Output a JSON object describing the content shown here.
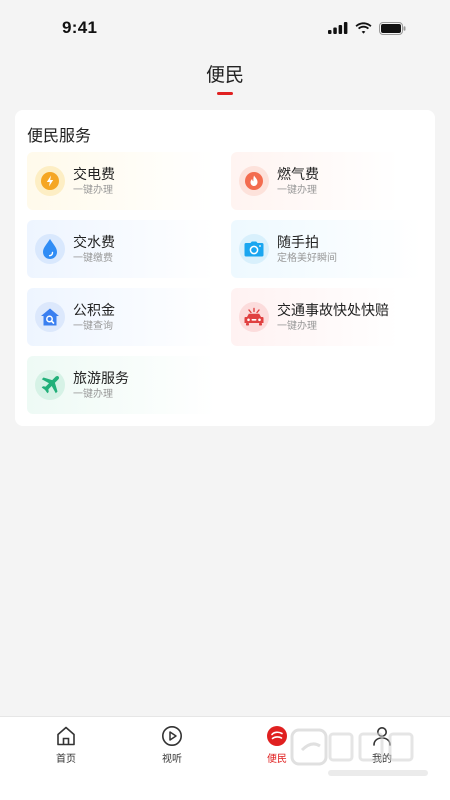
{
  "status": {
    "time": "9:41"
  },
  "nav": {
    "title": "便民"
  },
  "section": {
    "title": "便民服务",
    "items": [
      {
        "label": "交电费",
        "sub": "一键办理",
        "icon": "lightning-icon",
        "color": "#f5a623"
      },
      {
        "label": "燃气费",
        "sub": "一键办理",
        "icon": "flame-icon",
        "color": "#f36c4f"
      },
      {
        "label": "交水费",
        "sub": "一键缴费",
        "icon": "water-drop-icon",
        "color": "#2f8cf5"
      },
      {
        "label": "随手拍",
        "sub": "定格美好瞬间",
        "icon": "camera-icon",
        "color": "#1aa6f0"
      },
      {
        "label": "公积金",
        "sub": "一键查询",
        "icon": "house-search-icon",
        "color": "#3a7ff0"
      },
      {
        "label": "交通事故快处快赔",
        "sub": "一键办理",
        "icon": "car-accident-icon",
        "color": "#e04040"
      },
      {
        "label": "旅游服务",
        "sub": "一键办理",
        "icon": "airplane-icon",
        "color": "#22b07a"
      }
    ]
  },
  "tabbar": {
    "items": [
      {
        "label": "首页",
        "icon": "home-icon"
      },
      {
        "label": "视听",
        "icon": "play-icon"
      },
      {
        "label": "便民",
        "icon": "convenience-icon",
        "active": true
      },
      {
        "label": "我的",
        "icon": "user-icon"
      }
    ]
  },
  "colors": {
    "accent": "#e02020",
    "background": "#f4f4f4"
  }
}
